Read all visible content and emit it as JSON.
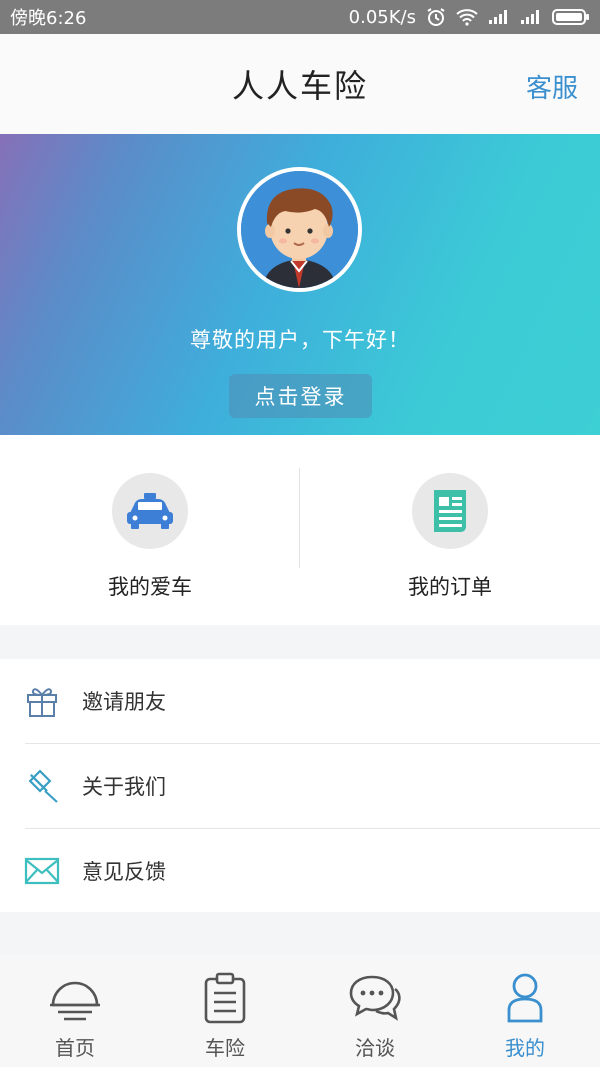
{
  "status_bar": {
    "time": "傍晚6:26",
    "speed": "0.05K/s"
  },
  "header": {
    "title": "人人车险",
    "service_label": "客服"
  },
  "hero": {
    "greeting": "尊敬的用户，下午好！",
    "login_label": "点击登录"
  },
  "quick_actions": [
    {
      "label": "我的爱车",
      "icon": "car-icon"
    },
    {
      "label": "我的订单",
      "icon": "document-icon"
    }
  ],
  "menu": [
    {
      "label": "邀请朋友",
      "icon": "gift-icon"
    },
    {
      "label": "关于我们",
      "icon": "pin-icon"
    },
    {
      "label": "意见反馈",
      "icon": "mail-icon"
    }
  ],
  "tabs": [
    {
      "label": "首页",
      "icon": "sunrise-icon"
    },
    {
      "label": "车险",
      "icon": "clipboard-icon"
    },
    {
      "label": "洽谈",
      "icon": "chat-icon"
    },
    {
      "label": "我的",
      "icon": "person-icon"
    }
  ],
  "colors": {
    "accent": "#3a8fcf",
    "teal": "#3ccfd4",
    "icon_blue": "#3d7fd6",
    "icon_green": "#3dbfa8"
  }
}
